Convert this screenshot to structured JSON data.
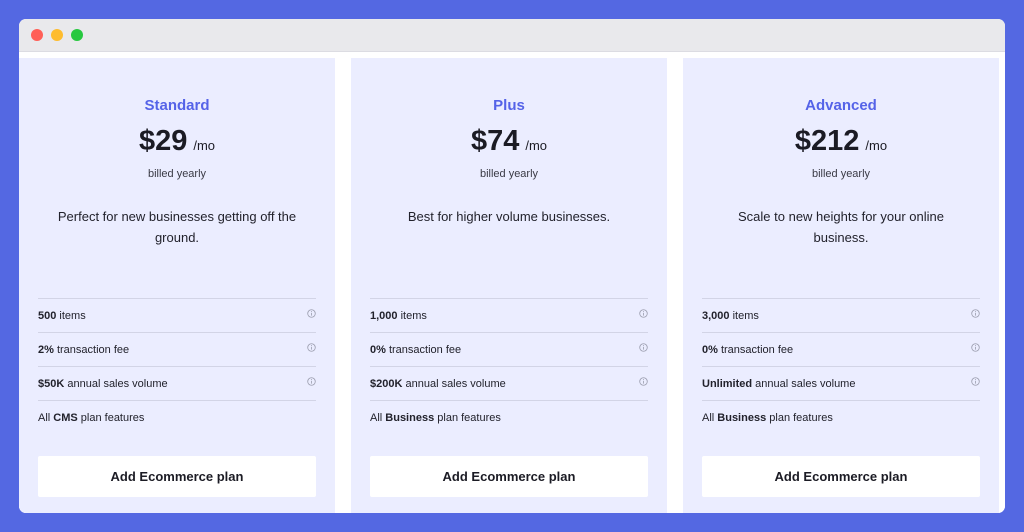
{
  "plans": [
    {
      "name": "Standard",
      "price": "$29",
      "per": "/mo",
      "billed": "billed yearly",
      "description": "Perfect for new businesses getting off the ground.",
      "features": [
        {
          "bold": "500",
          "rest": " items"
        },
        {
          "bold": "2%",
          "rest": " transaction fee"
        },
        {
          "bold": "$50K",
          "rest": " annual sales volume"
        },
        {
          "pre": "All ",
          "bold": "CMS",
          "rest": " plan features"
        }
      ],
      "cta": "Add Ecommerce plan"
    },
    {
      "name": "Plus",
      "price": "$74",
      "per": "/mo",
      "billed": "billed yearly",
      "description": "Best for higher volume businesses.",
      "features": [
        {
          "bold": "1,000",
          "rest": " items"
        },
        {
          "bold": "0%",
          "rest": " transaction fee"
        },
        {
          "bold": "$200K",
          "rest": " annual sales volume"
        },
        {
          "pre": "All ",
          "bold": "Business",
          "rest": " plan features"
        }
      ],
      "cta": "Add Ecommerce plan"
    },
    {
      "name": "Advanced",
      "price": "$212",
      "per": "/mo",
      "billed": "billed yearly",
      "description": "Scale to new heights for your online business.",
      "features": [
        {
          "bold": "3,000",
          "rest": " items"
        },
        {
          "bold": "0%",
          "rest": " transaction fee"
        },
        {
          "bold": "Unlimited",
          "rest": " annual sales volume"
        },
        {
          "pre": "All ",
          "bold": "Business",
          "rest": " plan features"
        }
      ],
      "cta": "Add Ecommerce plan"
    }
  ],
  "colors": {
    "background": "#5468e2",
    "card": "#ebedff",
    "accent": "#5563e8"
  },
  "icons": {
    "info": "info-icon"
  }
}
